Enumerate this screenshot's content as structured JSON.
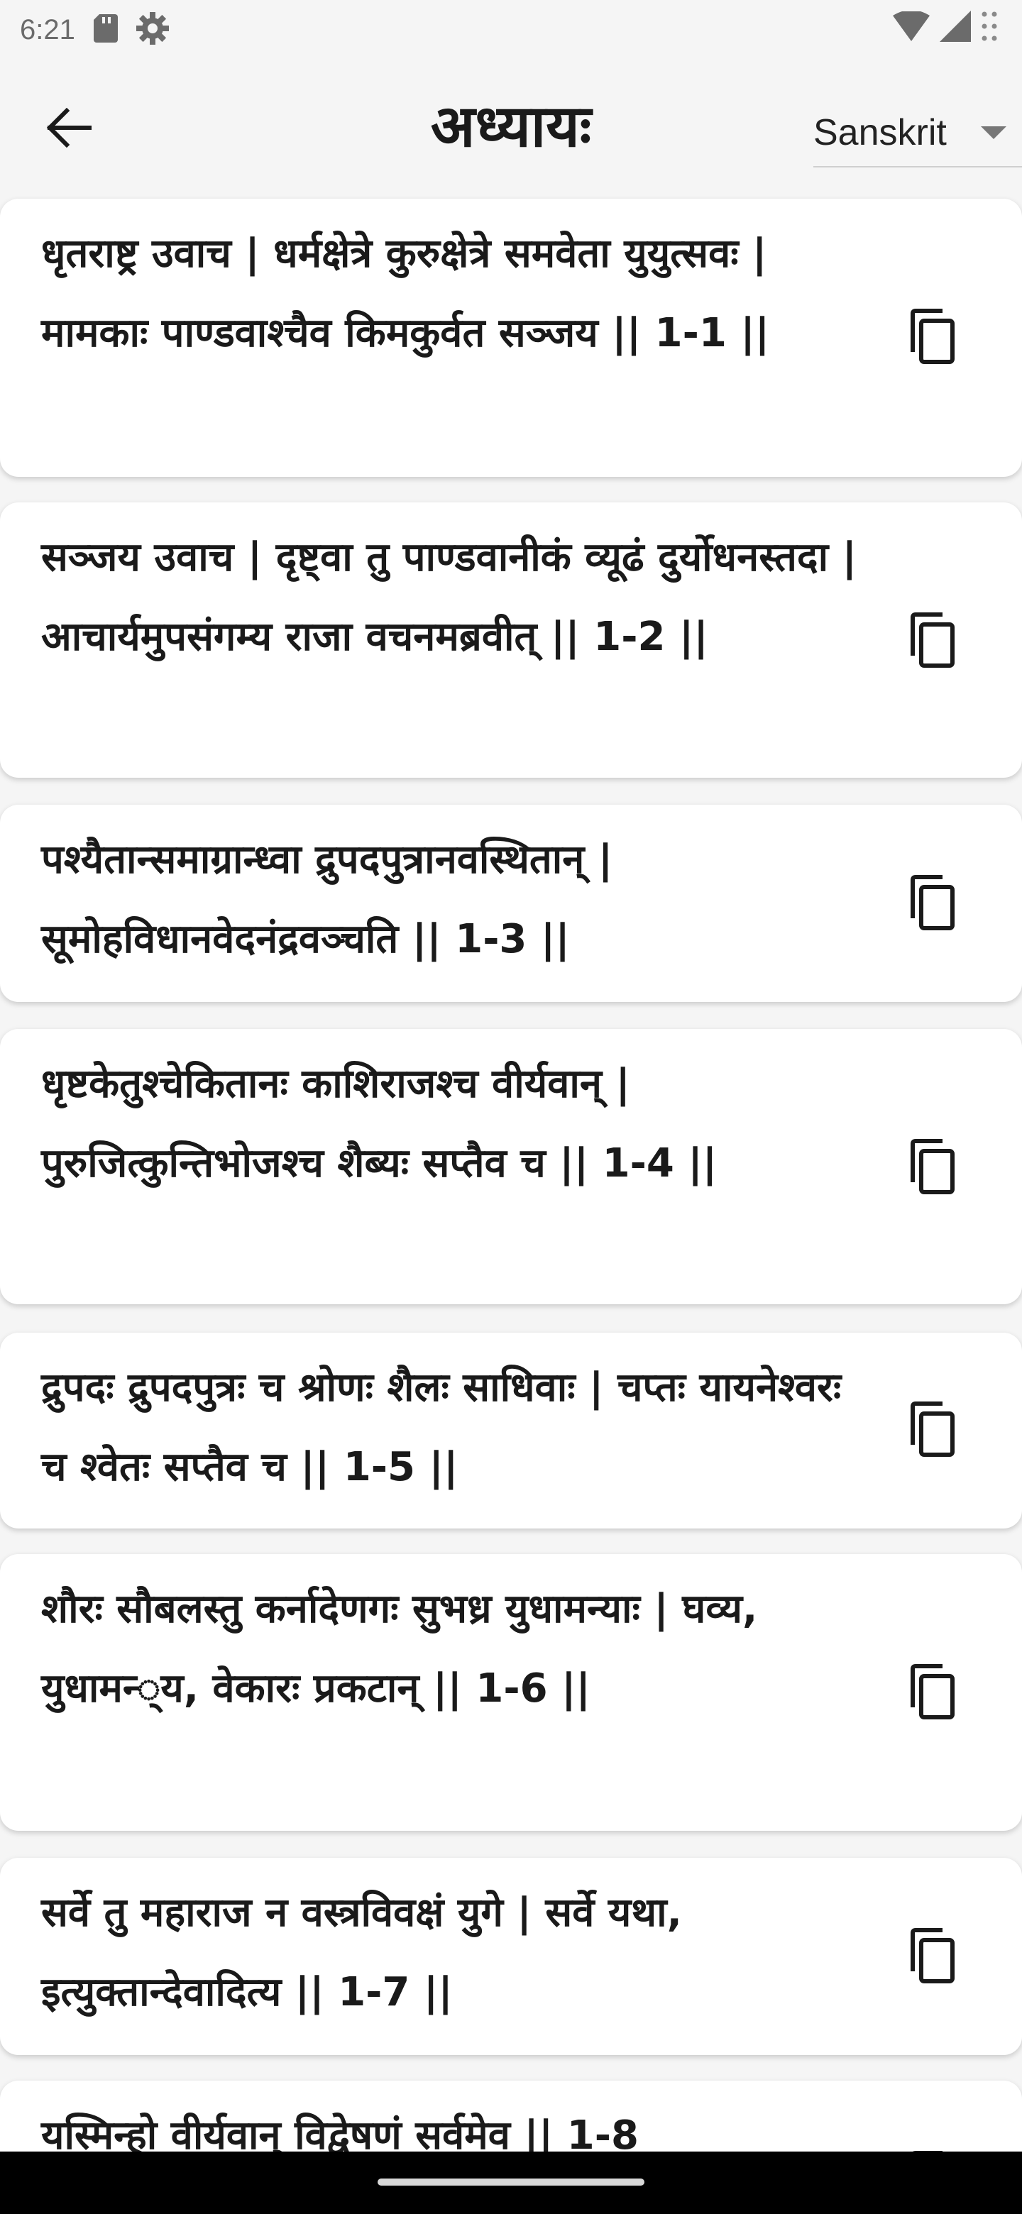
{
  "status_bar": {
    "time": "6:21",
    "left_icons": [
      "sd-card-icon",
      "gear-icon"
    ],
    "right_icons": [
      "wifi-icon",
      "signal-icon",
      "more-dots-icon"
    ]
  },
  "header": {
    "back_icon": "arrow-back-icon",
    "title": "अध्यायः",
    "language": {
      "selected": "Sanskrit",
      "icon": "caret-down-icon"
    }
  },
  "verses": [
    {
      "text": "धृतराष्ट्र उवाच | धर्मक्षेत्रे कुरुक्षेत्रे समवेता युयुत्सवः | मामकाः पाण्डवाश्चैव किमकुर्वत सञ्जय || 1-1 ||"
    },
    {
      "text": "सञ्जय उवाच | दृष्ट्वा तु पाण्डवानीकं व्यूढं दुर्योधनस्तदा | आचार्यमुपसंगम्य राजा वचनमब्रवीत् || 1-2 ||"
    },
    {
      "text": "पश्यैतान्समाग्रान्ध्वा द्रुपदपुत्रानवस्थितान् | सूमोहविधानवेदनंद्रवञ्चति || 1-3 ||"
    },
    {
      "text": "धृष्टकेतुश्चेकितानः काशिराजश्च वीर्यवान् | पुरुजित्कुन्तिभोजश्च शैब्यः सप्तैव च || 1-4 ||"
    },
    {
      "text": "द्रुपदः द्रुपदपुत्रः च श्रोणः शैलः साधिवाः | चप्तः यायनेश्वरः च श्वेतः सप्तैव च || 1-5 ||"
    },
    {
      "text": "शौरः सौबलस्तु कर्नादेणगः सुभध्र युधामन्याः | घव्य, युधामन्‍्य, वेकारः प्रकटान् || 1-6 ||"
    },
    {
      "text": "सर्वे तु महाराज न वस्त्रविवक्षं युगे | सर्वे यथा, इत्युक्तान्देवादित्य || 1-7 ||"
    },
    {
      "text": "यस्मिन्हो वीर्यवान् विद्वेषणं सर्वमेव || 1-8"
    }
  ],
  "copy_icon": "copy-icon"
}
